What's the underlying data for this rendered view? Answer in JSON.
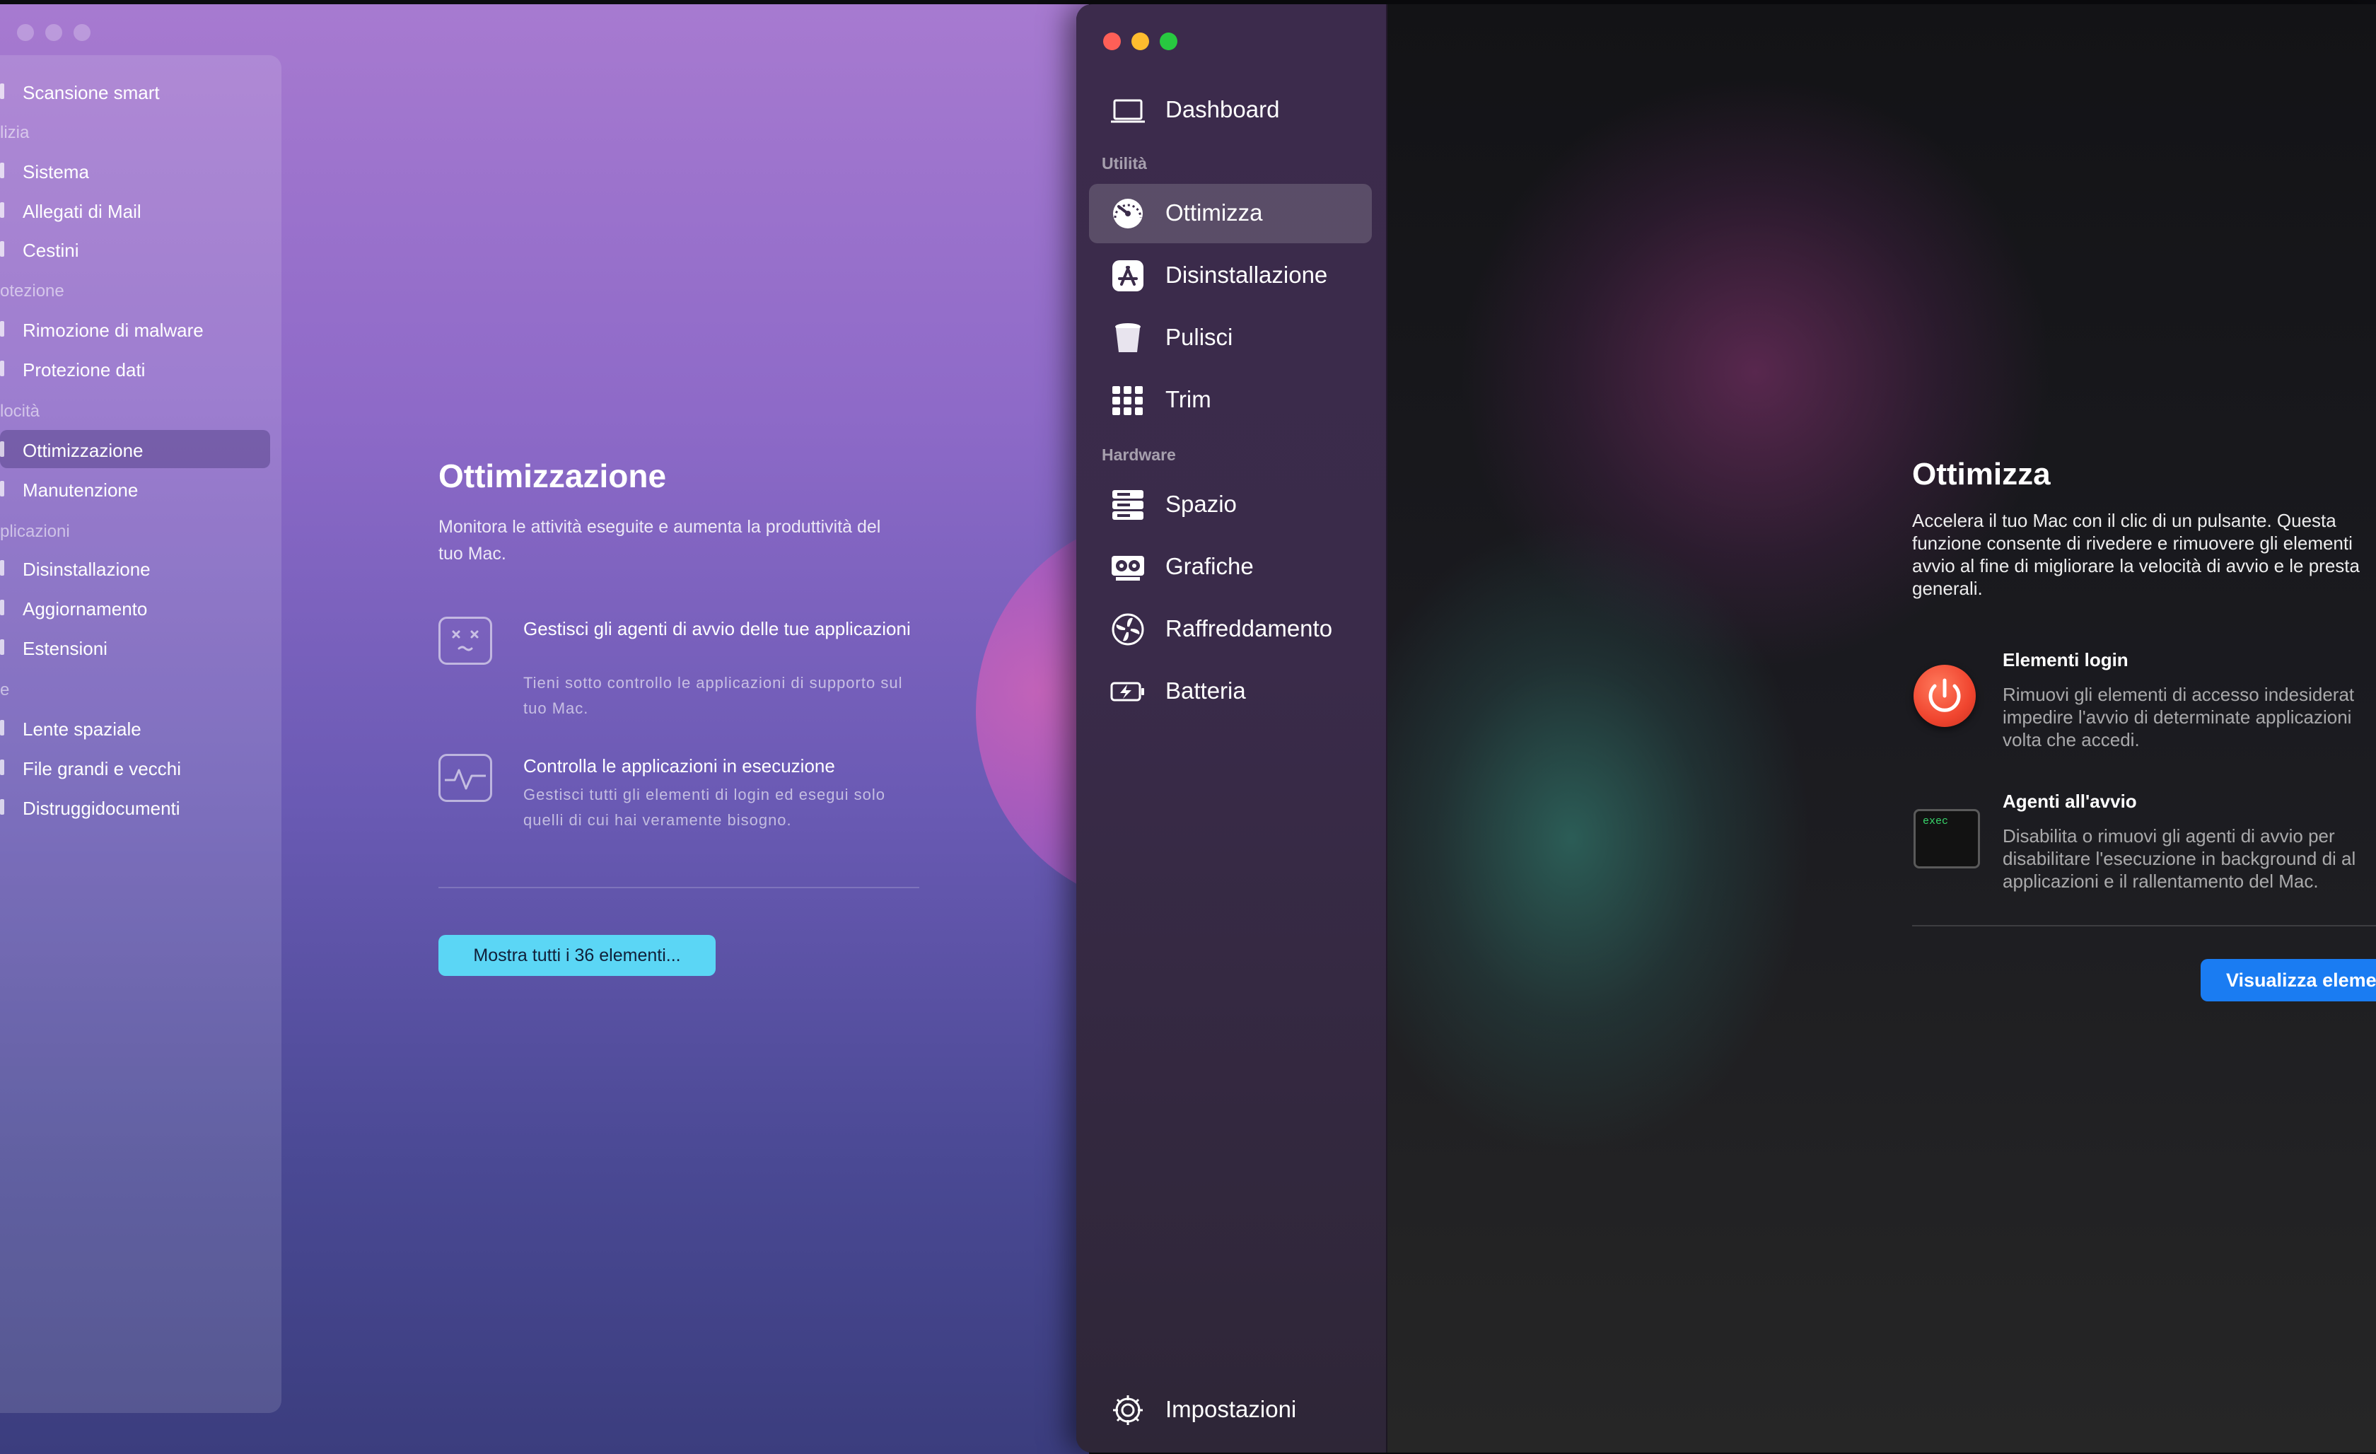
{
  "back_window": {
    "sidebar": {
      "items": [
        {
          "label": "Scansione smart"
        },
        {
          "label": "Sistema"
        },
        {
          "label": "Allegati di Mail"
        },
        {
          "label": "Cestini"
        },
        {
          "label": "Rimozione di malware"
        },
        {
          "label": "Protezione dati"
        },
        {
          "label": "Ottimizzazione"
        },
        {
          "label": "Manutenzione"
        },
        {
          "label": "Disinstallazione"
        },
        {
          "label": "Aggiornamento"
        },
        {
          "label": "Estensioni"
        },
        {
          "label": "Lente spaziale"
        },
        {
          "label": "File grandi e vecchi"
        },
        {
          "label": "Distruggidocumenti"
        }
      ],
      "headers": [
        "lizia",
        "otezione",
        "locità",
        "plicazioni",
        "e"
      ],
      "selected": "Ottimizzazione"
    },
    "content": {
      "title": "Ottimizzazione",
      "description": "Monitora le attività eseguite e aumenta la produttività del tuo Mac.",
      "features": [
        {
          "title": "Gestisci gli agenti di avvio delle tue applicazioni",
          "subtitle": "Tieni sotto controllo le applicazioni di supporto sul tuo Mac."
        },
        {
          "title": "Controlla le applicazioni in esecuzione",
          "subtitle": "Gestisci tutti gli elementi di login ed esegui solo quelli di cui hai veramente bisogno."
        }
      ],
      "button_label": "Mostra tutti i 36 elementi..."
    }
  },
  "front_window": {
    "sidebar": {
      "dashboard": "Dashboard",
      "section_utility": "Utilità",
      "utility_items": [
        {
          "label": "Ottimizza",
          "icon": "speedometer-icon"
        },
        {
          "label": "Disinstallazione",
          "icon": "app-store-icon"
        },
        {
          "label": "Pulisci",
          "icon": "trash-bin-icon"
        },
        {
          "label": "Trim",
          "icon": "grid-icon"
        }
      ],
      "section_hardware": "Hardware",
      "hardware_items": [
        {
          "label": "Spazio",
          "icon": "server-icon"
        },
        {
          "label": "Grafiche",
          "icon": "graphics-card-icon"
        },
        {
          "label": "Raffreddamento",
          "icon": "fan-icon"
        },
        {
          "label": "Batteria",
          "icon": "battery-icon"
        }
      ],
      "settings": "Impostazioni",
      "selected": "Ottimizza"
    },
    "main": {
      "title": "Ottimizza",
      "description": "Accelera il tuo Mac con il clic di un pulsante. Questa funzione consente di rivedere e rimuovere gli elementi avvio al fine di migliorare la velocità di avvio e le presta generali.",
      "features": [
        {
          "title": "Elementi login",
          "subtitle": "Rimuovi gli elementi di accesso indesiderat impedire l'avvio di determinate applicazioni volta che accedi."
        },
        {
          "title": "Agenti all'avvio",
          "subtitle": "Disabilita o rimuovi gli agenti di avvio per disabilitare l'esecuzione in background di al applicazioni e il rallentamento del Mac."
        }
      ],
      "exec_label": "exec",
      "button_label": "Visualizza elemen"
    }
  },
  "colors": {
    "accent_blue": "#1a7cf2",
    "accent_cyan": "#5bd6f5",
    "power_red": "#f0452f",
    "close": "#fe5f57",
    "minimize": "#febc2e",
    "zoom": "#28c840"
  }
}
